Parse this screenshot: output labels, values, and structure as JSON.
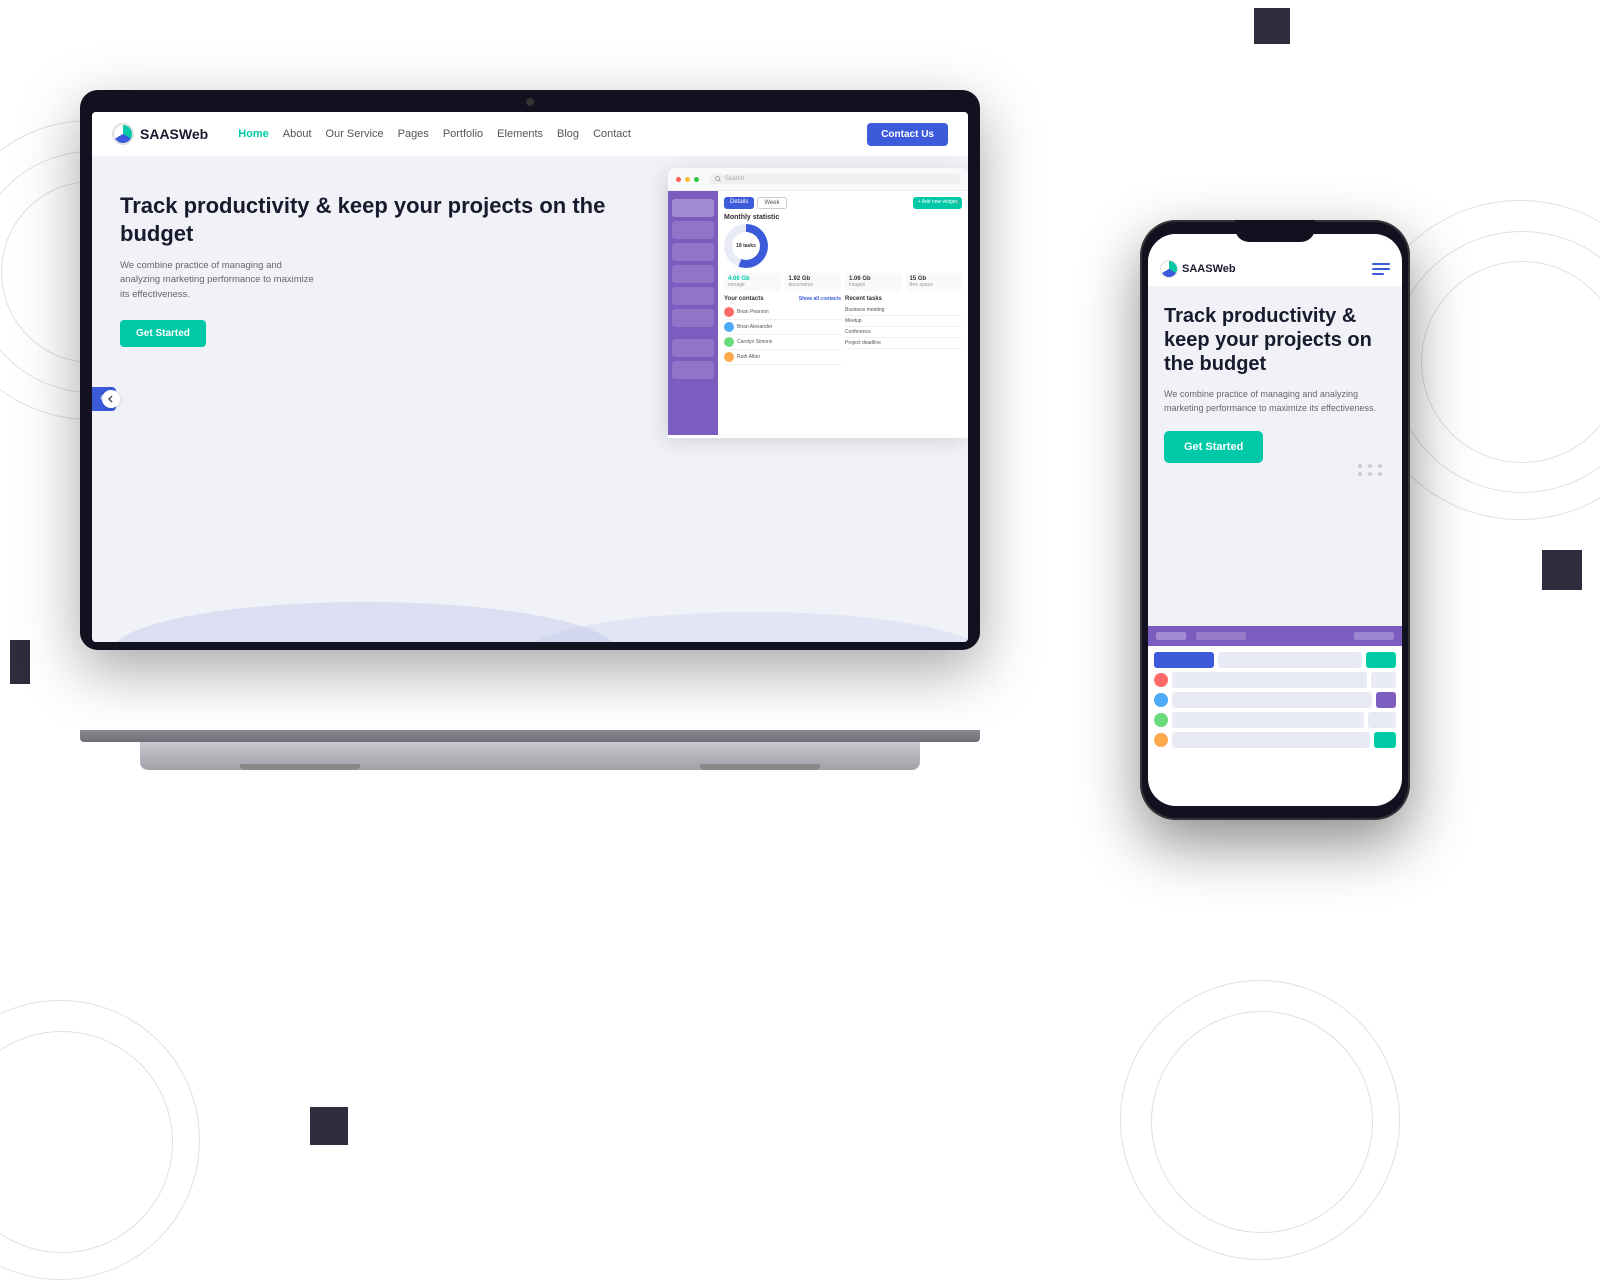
{
  "background": {
    "color": "#ffffff"
  },
  "logo": {
    "text_bold": "SAAS",
    "text_light": "Web"
  },
  "nav": {
    "links": [
      "Home",
      "About",
      "Our Service",
      "Pages",
      "Portfolio",
      "Elements",
      "Blog",
      "Contact"
    ],
    "active": "Home",
    "cta": "Contact Us"
  },
  "hero": {
    "headline": "Track productivity & keep your projects on the budget",
    "subtext": "We combine practice of managing and analyzing marketing performance to maximize its effectiveness.",
    "cta": "Get Started"
  },
  "phone_hero": {
    "headline": "Track productivity & keep your projects on the budget",
    "subtext": "We combine practice of managing and analyzing marketing performance to maximize its effectiveness.",
    "cta": "Get Started"
  },
  "dashboard": {
    "search_placeholder": "Search",
    "stats_title": "Monthly statistic",
    "tasks_count": "18 tasks",
    "metrics": [
      {
        "value": "4.06 Gb",
        "label": "storage"
      },
      {
        "value": "1.92 Gb",
        "label": "documents"
      },
      {
        "value": "1.06 Gb",
        "label": "images"
      },
      {
        "value": "15 Gb",
        "label": "free space"
      }
    ],
    "contacts_title": "Your contacts",
    "tasks_title": "Recent tasks"
  }
}
